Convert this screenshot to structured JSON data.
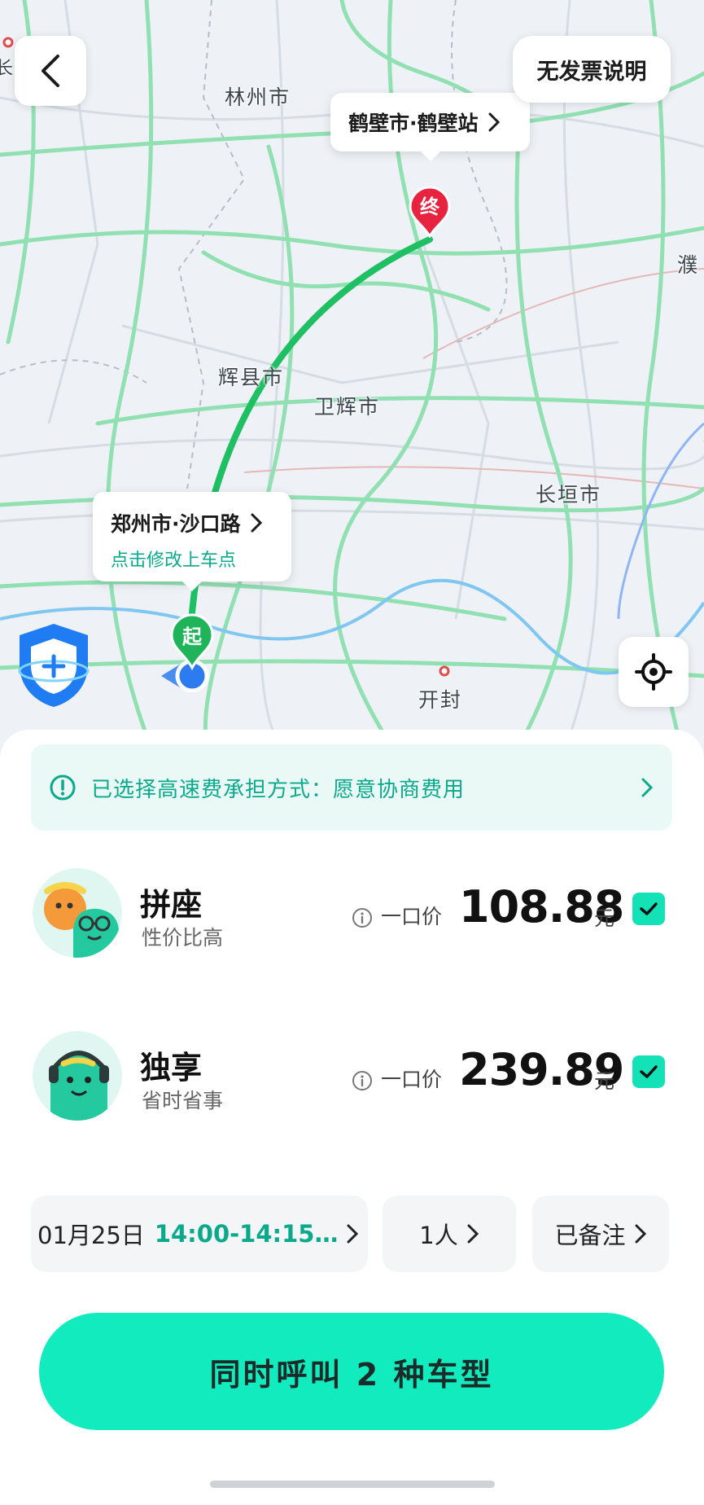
{
  "map": {
    "cities": [
      {
        "id": "linzhou",
        "label": "林州市"
      },
      {
        "id": "huixian",
        "label": "辉县市"
      },
      {
        "id": "weihui",
        "label": "卫辉市"
      },
      {
        "id": "changyuan",
        "label": "长垣市"
      },
      {
        "id": "kaifeng",
        "label": "开封"
      },
      {
        "id": "pu",
        "label": "濮"
      },
      {
        "id": "left_edge",
        "label": "长治"
      }
    ],
    "destination": {
      "label": "鹤壁市·鹤壁站",
      "marker": "终"
    },
    "origin": {
      "label": "郑州市·沙口路",
      "hint": "点击修改上车点",
      "marker": "起"
    },
    "invoice_label": "无发票说明",
    "route_color": "#1fbf63"
  },
  "notice": {
    "text": "已选择高速费承担方式：愿意协商费用"
  },
  "options": [
    {
      "name": "拼座",
      "subtitle": "性价比高",
      "price_label": "一口价",
      "price": "108.88",
      "unit": "元",
      "checked": true
    },
    {
      "name": "独享",
      "subtitle": "省时省事",
      "price_label": "一口价",
      "price": "239.89",
      "unit": "元",
      "checked": true
    }
  ],
  "chips": {
    "date": "01月25日",
    "time_range": "14:00-14:15…",
    "people": "1人",
    "note": "已备注"
  },
  "call_button": {
    "label": "同时呼叫 2 种车型"
  },
  "colors": {
    "accent": "#12ebbd",
    "accent_text": "#0aa98c",
    "origin_pin": "#1fb35a",
    "dest_pin": "#e8233f"
  }
}
